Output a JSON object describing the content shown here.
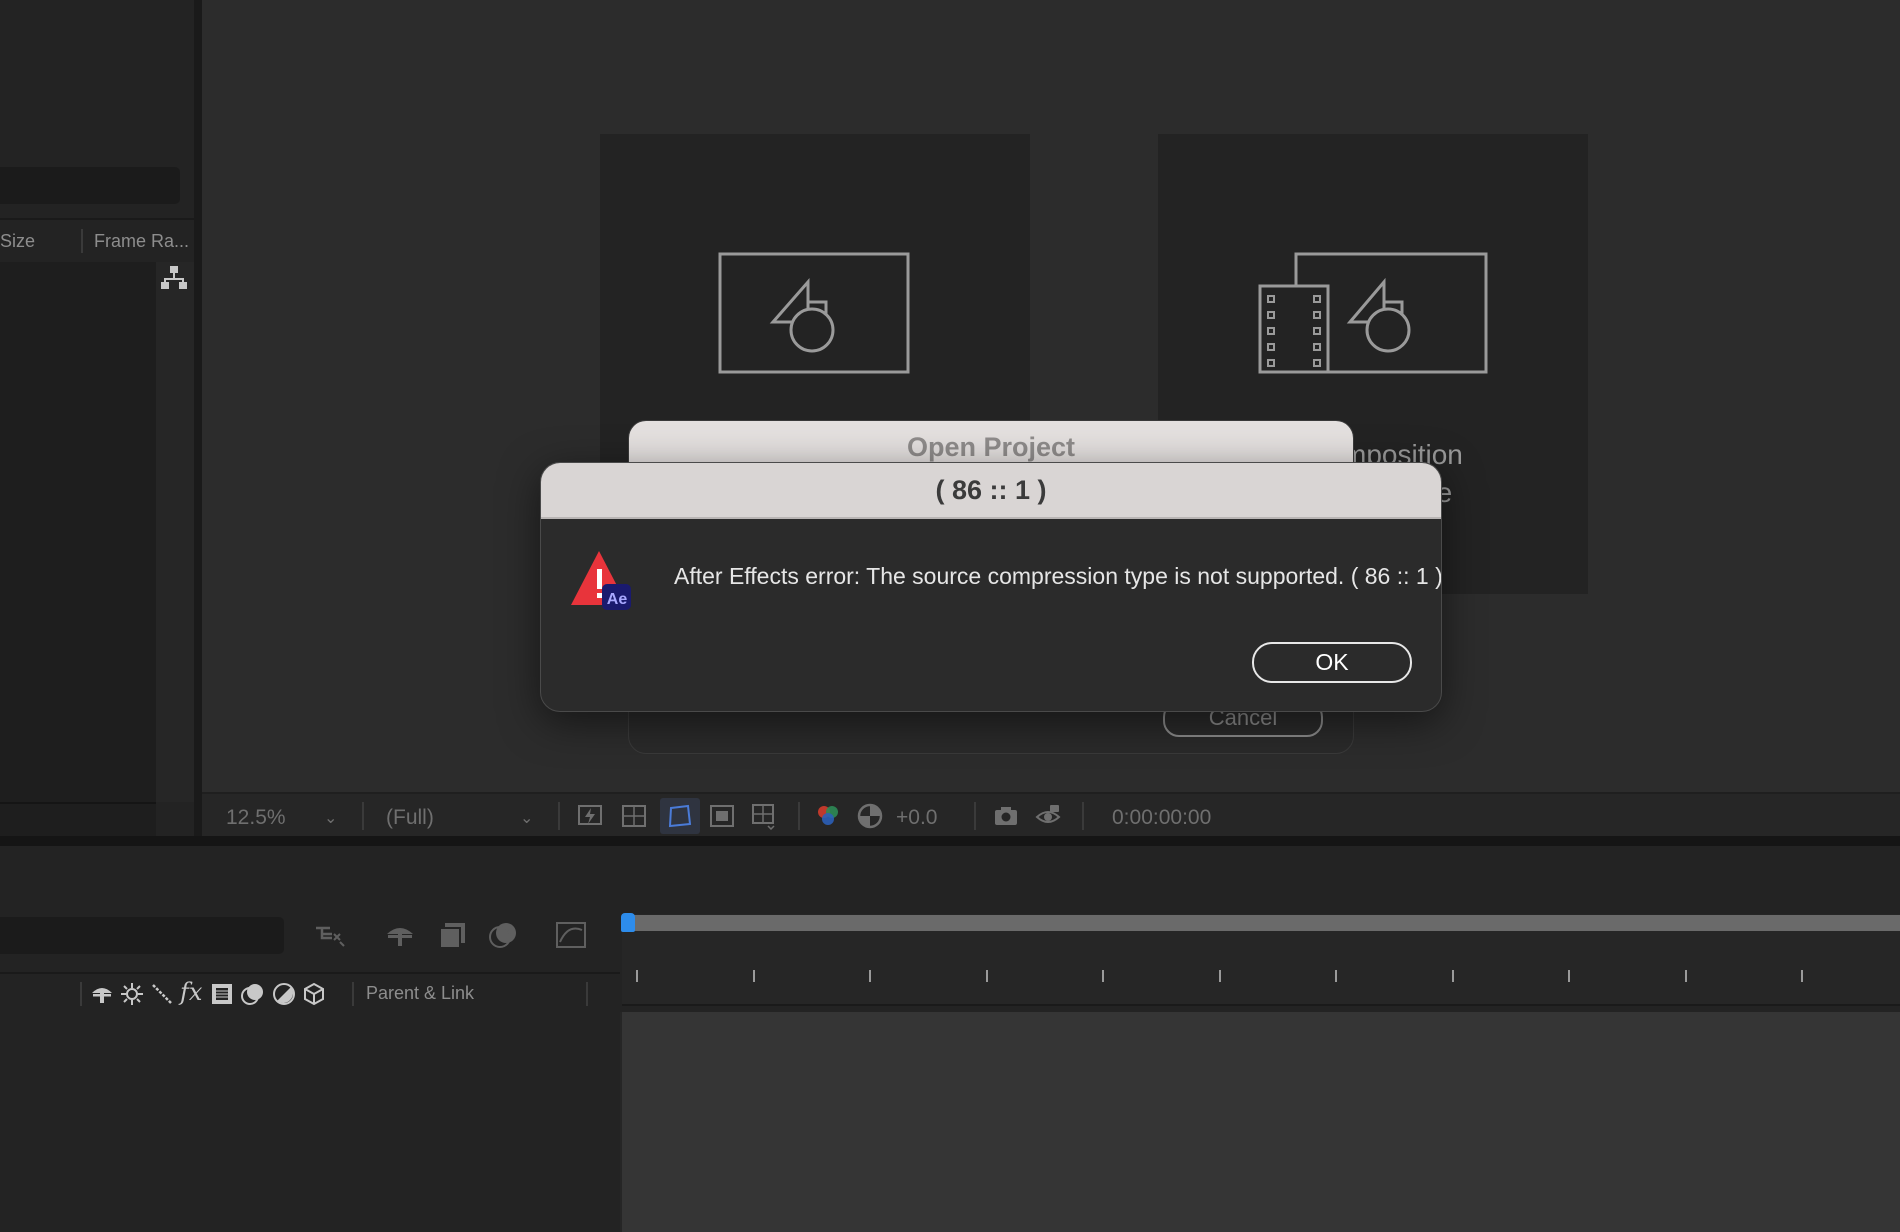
{
  "project_panel": {
    "columns": [
      "Size",
      "Frame Ra..."
    ]
  },
  "viewer": {
    "cards": [
      {
        "label_lines": [
          "",
          ""
        ]
      },
      {
        "label_lines": [
          "mposition",
          "ge"
        ]
      }
    ]
  },
  "viewer_toolbar": {
    "zoom": "12.5%",
    "resolution": "(Full)",
    "exposure": "+0.0",
    "timecode": "0:00:00:00"
  },
  "timeline": {
    "parent_link_label": "Parent & Link",
    "tick_count": 11
  },
  "open_project_dialog": {
    "title": "Open Project",
    "cancel_label": "Cancel"
  },
  "error_dialog": {
    "title": "( 86 :: 1 )",
    "message": "After Effects error: The source compression type is not supported. ( 86 :: 1 )",
    "ok_label": "OK",
    "icon_badge": "Ae"
  },
  "colors": {
    "accent_blue": "#2d8ceb",
    "warning_red": "#e8343b",
    "ae_badge": "#1a1a6e"
  }
}
